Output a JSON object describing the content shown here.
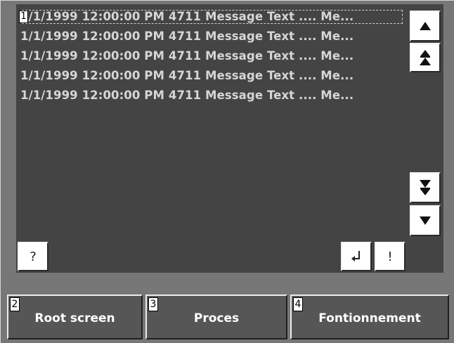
{
  "messages": [
    {
      "text": "1/1/1999 12:00:00 PM  4711 Message Text .... Me...",
      "selected": true
    },
    {
      "text": "1/1/1999 12:00:00 PM  4711 Message Text .... Me...",
      "selected": false
    },
    {
      "text": "1/1/1999 12:00:00 PM  4711 Message Text .... Me...",
      "selected": false
    },
    {
      "text": "1/1/1999 12:00:00 PM  4711 Message Text .... Me...",
      "selected": false
    },
    {
      "text": "1/1/1999 12:00:00 PM  4711 Message Text .... Me...",
      "selected": false
    }
  ],
  "message_list": {
    "field_number": "1"
  },
  "scroll_buttons": {
    "up_icon": "arrow-up",
    "page_up_icon": "double-arrow-up",
    "page_down_icon": "double-arrow-down",
    "down_icon": "arrow-down"
  },
  "actions": {
    "help_label": "?",
    "enter_icon": "return-arrow",
    "acknowledge_label": "!"
  },
  "function_keys": [
    {
      "number": "2",
      "label": "Root screen"
    },
    {
      "number": "3",
      "label": "Proces"
    },
    {
      "number": "4",
      "label": "Fontionnement"
    }
  ],
  "colors": {
    "background": "#777777",
    "panel": "#444444",
    "message_text": "#d6d6d6",
    "function_key": "#565656",
    "button_face": "#ffffff"
  }
}
